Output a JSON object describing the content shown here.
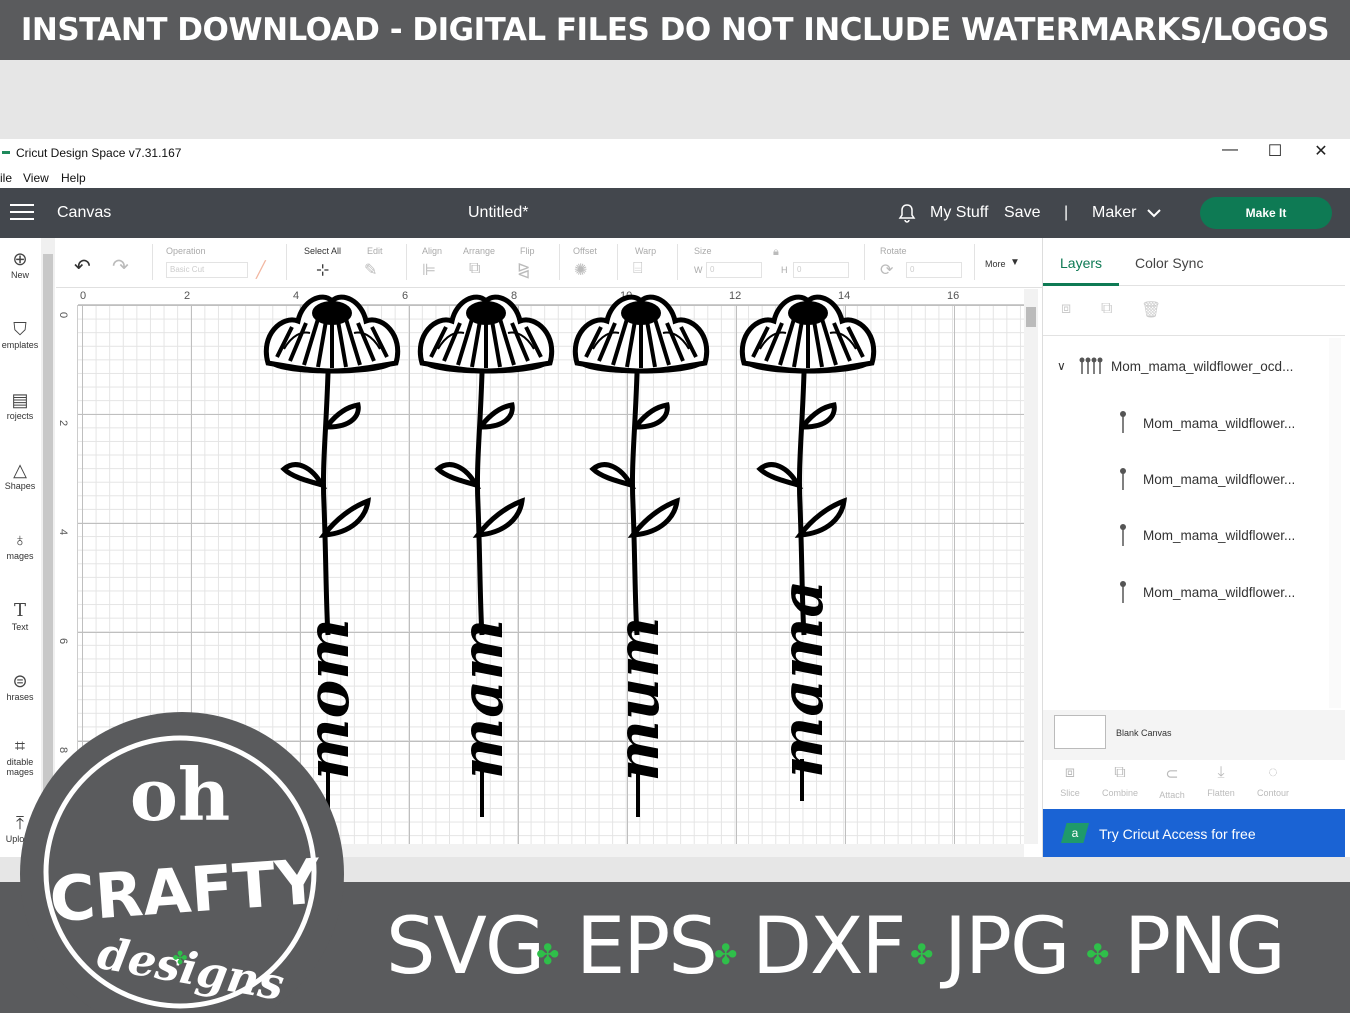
{
  "banner_top": "INSTANT DOWNLOAD - DIGITAL FILES DO NOT INCLUDE WATERMARKS/LOGOS",
  "window": {
    "title": "Cricut Design Space  v7.31.167",
    "menu": [
      "ile",
      "View",
      "Help"
    ],
    "controls": {
      "minimize": "—",
      "maximize": "☐",
      "close": "✕"
    }
  },
  "header": {
    "section": "Canvas",
    "doc_title": "Untitled*",
    "my_stuff": "My Stuff",
    "save": "Save",
    "divider": "|",
    "machine": "Maker",
    "make_it": "Make It"
  },
  "rail": [
    {
      "label": "New",
      "icon": "plus-circle-icon"
    },
    {
      "label": "emplates",
      "icon": "shirt-icon"
    },
    {
      "label": "rojects",
      "icon": "clipboard-icon"
    },
    {
      "label": "Shapes",
      "icon": "shapes-icon"
    },
    {
      "label": "mages",
      "icon": "lightbulb-icon"
    },
    {
      "label": "Text",
      "icon": "text-icon"
    },
    {
      "label": "hrases",
      "icon": "chat-icon"
    },
    {
      "label": "ditable",
      "label2": "mages",
      "icon": "editable-icon"
    },
    {
      "label": "Upload",
      "icon": "upload-icon"
    }
  ],
  "toolbar": {
    "operation": "Operation",
    "operation_value": "Basic Cut",
    "select_all": "Select All",
    "edit": "Edit",
    "align": "Align",
    "arrange": "Arrange",
    "flip": "Flip",
    "offset": "Offset",
    "warp": "Warp",
    "size": "Size",
    "w": "W",
    "h": "H",
    "w_value": "0",
    "h_value": "0",
    "rotate": "Rotate",
    "rotate_value": "0",
    "more": "More"
  },
  "ruler": {
    "top": [
      "0",
      "2",
      "4",
      "6",
      "8",
      "10",
      "12",
      "14",
      "16"
    ],
    "left": [
      "0",
      "2",
      "4",
      "6",
      "8"
    ]
  },
  "canvas_words": [
    "mom",
    "mam",
    "mum",
    "mama"
  ],
  "panel": {
    "tab_layers": "Layers",
    "tab_color_sync": "Color Sync",
    "group_name": "Mom_mama_wildflower_ocd...",
    "layers": [
      "Mom_mama_wildflower...",
      "Mom_mama_wildflower...",
      "Mom_mama_wildflower...",
      "Mom_mama_wildflower..."
    ],
    "blank_canvas": "Blank Canvas",
    "tools": [
      "Slice",
      "Combine",
      "Attach",
      "Flatten",
      "Contour"
    ],
    "access_badge": "a",
    "access_text": "Try Cricut Access for free"
  },
  "formats": [
    "SVG",
    "EPS",
    "DXF",
    "JPG",
    "PNG"
  ],
  "logo": {
    "line1": "oh",
    "line2": "CRAFTY",
    "line3": "designs"
  },
  "colors": {
    "header": "#43474d",
    "accent": "#0e7a54",
    "access": "#1a63d4",
    "banner": "#5a5b5d",
    "clover": "#2fbf4a"
  }
}
